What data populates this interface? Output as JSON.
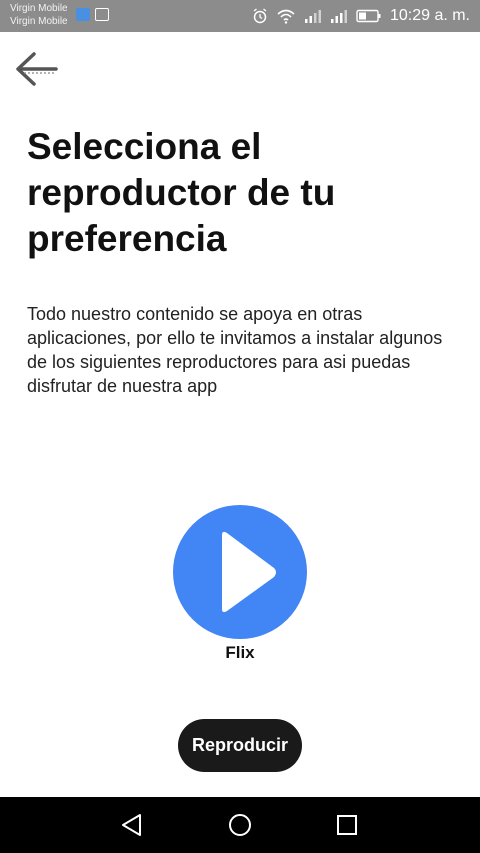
{
  "status_bar": {
    "carrier_1": "Virgin Mobile",
    "carrier_2": "Virgin Mobile",
    "time": "10:29 a. m.",
    "icons": [
      "notification-icon",
      "gallery-icon",
      "alarm-icon",
      "wifi-icon",
      "signal-icon",
      "signal-icon",
      "battery-icon"
    ]
  },
  "header": {
    "back_icon": "arrow-left-icon"
  },
  "main": {
    "title": "Selecciona el reproductor de tu preferencia",
    "description": "Todo nuestro contenido se apoya en otras aplicaciones, por ello te invitamos a instalar algunos de los siguientes reproductores para asi puedas disfrutar de nuestra app",
    "players": [
      {
        "name": "Flix",
        "icon": "play-icon",
        "color": "#4285f4"
      }
    ],
    "action_button": "Reproducir"
  },
  "nav_bar": {
    "icons": [
      "back-triangle-icon",
      "home-circle-icon",
      "recents-square-icon"
    ]
  },
  "colors": {
    "accent": "#4285f4",
    "button": "#1a1a1a",
    "status_bar": "#8c8c8c",
    "nav_bar": "#000000"
  }
}
